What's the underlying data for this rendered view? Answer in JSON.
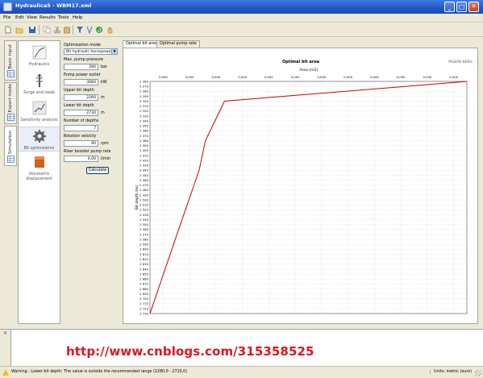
{
  "window": {
    "title": "Hydraulica5 - WBM17.xml",
    "controls": {
      "minimize": "_",
      "maximize": "□",
      "close": "✕"
    }
  },
  "menu": [
    "File",
    "Edit",
    "View",
    "Results",
    "Tools",
    "Help"
  ],
  "toolbar": {
    "icons": [
      "new-file-icon",
      "open-folder-icon",
      "save-icon",
      "copy-icon",
      "cut-icon",
      "paste-icon",
      "filter-icon",
      "wellbore-icon",
      "refresh-icon",
      "hand-icon"
    ]
  },
  "side_tabs": [
    "Basic input",
    "Expert mode",
    "Simulation"
  ],
  "nav": [
    {
      "label": "Hydraulics",
      "icon": "hydraulics-icon"
    },
    {
      "label": "Surge and swab",
      "icon": "surge-swab-icon"
    },
    {
      "label": "Sensitivity analysis",
      "icon": "sensitivity-icon"
    },
    {
      "label": "Bit optimization",
      "icon": "gear-icon"
    },
    {
      "label": "Volumetric displacement",
      "icon": "volumetric-icon"
    }
  ],
  "params": {
    "opt_mode_label": "Optimization mode",
    "opt_mode_value": "Bit hydraulic horsepower",
    "max_pump_pressure_label": "Max. pump pressure",
    "max_pump_pressure_value": "280",
    "max_pump_pressure_unit": "bar",
    "pump_power_label": "Pump power outlet",
    "pump_power_value": "3060",
    "pump_power_unit": "kW",
    "upper_depth_label": "Upper bit depth",
    "upper_depth_value": "2260",
    "upper_depth_unit": "m",
    "lower_depth_label": "Lower bit depth",
    "lower_depth_value": "2730",
    "lower_depth_unit": "m",
    "num_depths_label": "Number of depths",
    "num_depths_value": "7",
    "rotation_label": "Rotation velocity",
    "rotation_value": "90",
    "rotation_unit": "rpm",
    "riser_label": "Riser booster pump rate",
    "riser_value": "0,00",
    "riser_unit": "l/min",
    "calculate_label": "Calculate"
  },
  "chart_tabs": [
    "Optimal bit area",
    "Optimal pump rate"
  ],
  "chart_data": {
    "type": "line",
    "title": "Optimal bit area",
    "xlabel": "Area (m2)",
    "ylabel": "Bit depth (m)",
    "x_ticks": [
      "0,000",
      "0,000",
      "0,000",
      "0,000",
      "0,000",
      "0,000",
      "0,000",
      "0,000",
      "0,000",
      "0,000",
      "0,000",
      "0,000"
    ],
    "y_ticks": [
      "2 260",
      "2 270",
      "2 280",
      "2 290",
      "2 300",
      "2 310",
      "2 320",
      "2 330",
      "2 340",
      "2 350",
      "2 360",
      "2 370",
      "2 380",
      "2 390",
      "2 400",
      "2 410",
      "2 420",
      "2 430",
      "2 440",
      "2 450",
      "2 460",
      "2 470",
      "2 480",
      "2 490",
      "2 500",
      "2 510",
      "2 520",
      "2 530",
      "2 540",
      "2 550",
      "2 560",
      "2 570",
      "2 580",
      "2 590",
      "2 600",
      "2 610",
      "2 620",
      "2 630",
      "2 640",
      "2 650",
      "2 660",
      "2 670",
      "2 680",
      "2 690",
      "2 700",
      "2 710",
      "2 720",
      "2 730"
    ],
    "ylim": [
      2260,
      2730
    ],
    "y_inverted": true,
    "x_domain": [
      0,
      1
    ],
    "series": [
      {
        "x": [
          0.0,
          0.085,
          0.155,
          0.175,
          0.235,
          1.0
        ],
        "y": [
          2730,
          2570,
          2440,
          2380,
          2300,
          2260
        ],
        "color": "#cc0000"
      }
    ],
    "grid": true,
    "logo": "PEAUW BERG"
  },
  "log": {
    "watermark": "http://www.cnblogs.com/315358525"
  },
  "status": {
    "warning": "Warning : Lower bit depth: The value is outside the recommended range (2280,0 - 2710,0)",
    "units": "Units: metric (euro)"
  },
  "colors": {
    "title_bar": "#2457c6",
    "chart_line": "#cc0000",
    "watermark": "#e0141e"
  }
}
